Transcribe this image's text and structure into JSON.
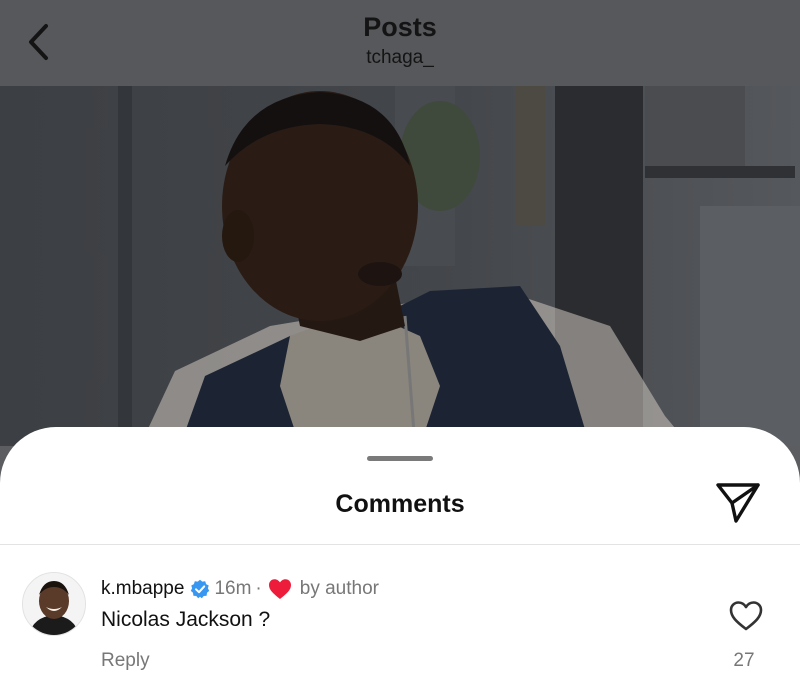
{
  "header": {
    "title": "Posts",
    "subtitle": "tchaga_",
    "back_icon": "chevron-left-icon"
  },
  "sheet": {
    "title": "Comments",
    "share_icon": "paper-plane-icon"
  },
  "comments": [
    {
      "username": "k.mbappe",
      "verified": true,
      "time": "16m",
      "separator": "·",
      "author_like_label": "by author",
      "text": "Nicolas Jackson ?",
      "reply_label": "Reply",
      "like_count": "27"
    }
  ],
  "colors": {
    "verified_blue": "#3897f0",
    "like_red": "#ed1c3a",
    "muted_text": "#777777"
  }
}
